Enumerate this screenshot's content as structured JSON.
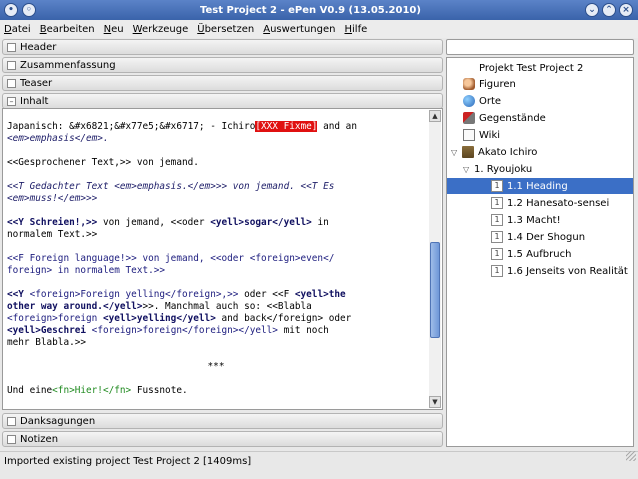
{
  "window": {
    "title": "Test Project 2 - ePen V0.9 (13.05.2010)"
  },
  "menu": [
    "Datei",
    "Bearbeiten",
    "Neu",
    "Werkzeuge",
    "Übersetzen",
    "Auswertungen",
    "Hilfe"
  ],
  "sections_top": [
    "Header",
    "Zusammenfassung",
    "Teaser",
    "Inhalt"
  ],
  "sections_bottom": [
    "Danksagungen",
    "Notizen"
  ],
  "editor": {
    "p1a": "Japanisch: &#x6821;&#x77e5;&#x6717; - Ichiro",
    "p1fix": "[XXX Fixme]",
    "p1b": " and an",
    "p1c": "<em>emphasis</em>.",
    "p2": "<<Gesprochener Text,>> von jemand.",
    "p3a": "<<T Gedachter Text <em>emphasis.</em>>> von jemand. <<T Es",
    "p3b": "<em>muss!</em>>>",
    "p4a": "<<Y Schreien!,>>",
    "p4b": " von jemand, <<oder ",
    "p4c": "<yell>sogar</yell>",
    "p4d": " in",
    "p4e": "normalem Text.>>",
    "p5a": "<<F Foreign language!>> von jemand, <<oder <foreign>even</",
    "p5b": "foreign> in normalem Text.>>",
    "p6a": "<<Y ",
    "p6b": "<foreign>Foreign yelling</foreign>,>>",
    "p6c": " oder <<F ",
    "p6d": "<yell>the",
    "p6e": "other way around.</yell>",
    "p6f": ">>. Manchmal auch so: <<Blabla",
    "p6g": "<foreign>foreign ",
    "p6h": "<yell>yelling</yell>",
    "p6i": " and back</foreign> oder",
    "p6j": "<yell>Geschrei ",
    "p6k": "<foreign>foreign</foreign></yell>",
    "p6l": " mit noch",
    "p6m": "mehr Blabla.>>",
    "p7": "***",
    "p8a": "Und eine",
    "p8b": "<fn>Hier!</fn>",
    "p8c": " Fussnote."
  },
  "tree": {
    "root": "Projekt Test Project 2",
    "figuren": "Figuren",
    "orte": "Orte",
    "gegenstaende": "Gegenstände",
    "wiki": "Wiki",
    "book": "Akato Ichiro",
    "chapter": "1. Ryoujoku",
    "pages": [
      "1.1 Heading",
      "1.2 Hanesato-sensei",
      "1.3 Macht!",
      "1.4 Der Shogun",
      "1.5 Aufbruch",
      "1.6 Jenseits von Realität"
    ]
  },
  "status": "Imported existing project Test Project 2 [1409ms]",
  "colors": {
    "selection": "#3b6fc6",
    "fixme": "#e01010",
    "scroll_thumb": "#6f97d8"
  }
}
